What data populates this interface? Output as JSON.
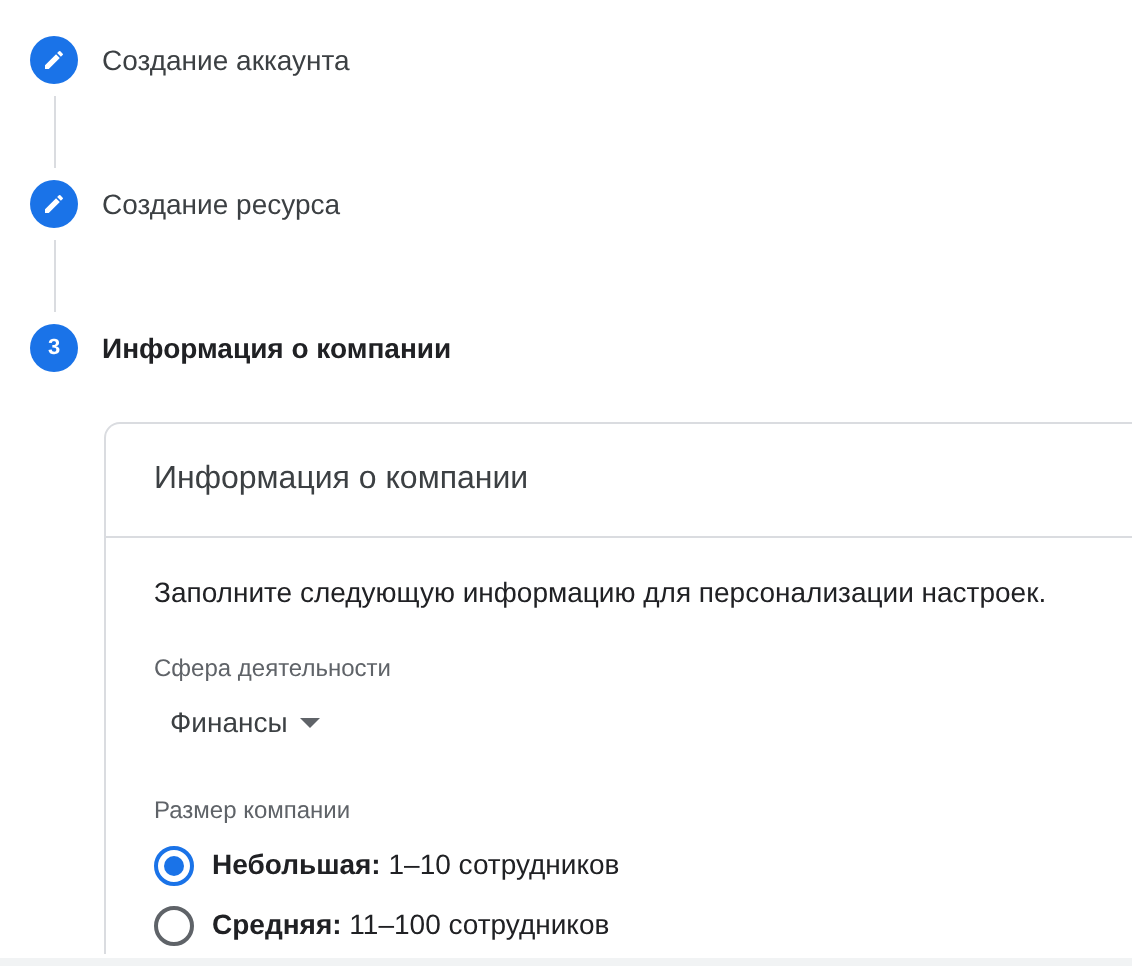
{
  "steps": [
    {
      "kind": "done",
      "label": "Создание аккаунта"
    },
    {
      "kind": "done",
      "label": "Создание ресурса"
    },
    {
      "kind": "current",
      "number": "3",
      "label": "Информация о компании"
    }
  ],
  "card": {
    "title": "Информация о компании",
    "intro": "Заполните следующую информацию для персонализации настроек.",
    "industry": {
      "label": "Сфера деятельности",
      "value": "Финансы"
    },
    "size": {
      "label": "Размер компании",
      "options": [
        {
          "text": "**Небольшая:** 1–10 сотрудников",
          "selected": true
        },
        {
          "text": "**Средняя:** 11–100 сотрудников",
          "selected": false
        }
      ]
    }
  }
}
